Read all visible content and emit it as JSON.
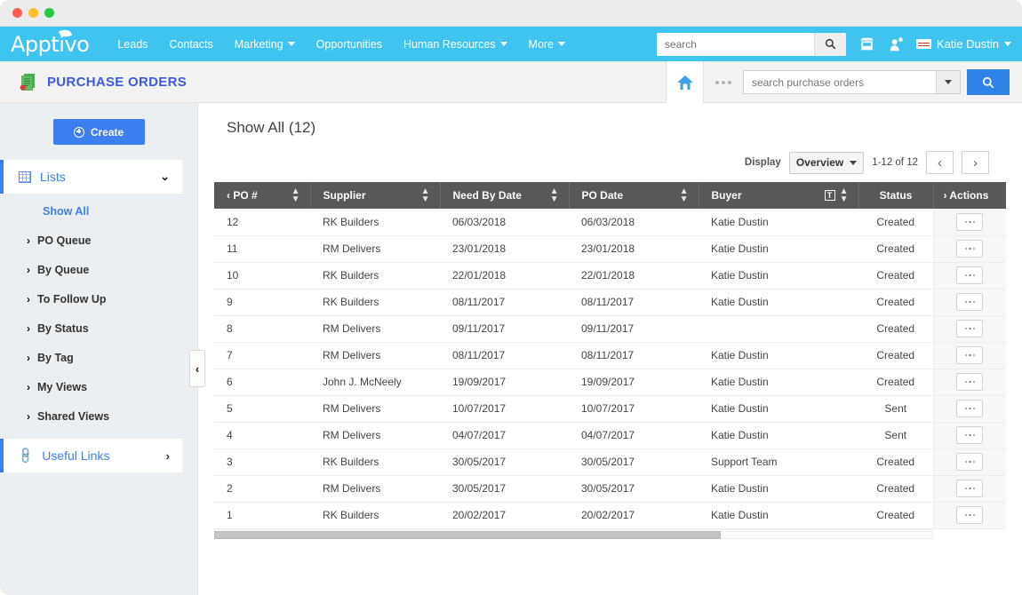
{
  "window": {
    "title": ""
  },
  "topnav": {
    "brand": "Apptivo",
    "links": [
      {
        "label": "Leads",
        "dropdown": false
      },
      {
        "label": "Contacts",
        "dropdown": false
      },
      {
        "label": "Marketing",
        "dropdown": true
      },
      {
        "label": "Opportunities",
        "dropdown": false
      },
      {
        "label": "Human Resources",
        "dropdown": true
      },
      {
        "label": "More",
        "dropdown": true
      }
    ],
    "search_placeholder": "search",
    "search_value": "",
    "user_name": "Katie Dustin",
    "icons": [
      "search-icon",
      "store-icon",
      "notifications-user-icon",
      "flag-icon",
      "chevron-down-icon"
    ]
  },
  "appbar": {
    "title": "PURCHASE ORDERS",
    "app_icon": "document-app-icon",
    "home_icon": "home-icon",
    "more_icon": "three-dots-icon",
    "search_placeholder": "search purchase orders",
    "search_value": "",
    "search_icon": "search-icon",
    "dropdown_icon": "chevron-down-icon"
  },
  "sidebar": {
    "create_label": "Create",
    "sections": [
      {
        "label": "Lists",
        "icon": "grid-icon",
        "chevron": "⌄",
        "expanded": true
      },
      {
        "label": "Useful Links",
        "icon": "link-icon",
        "chevron": "›",
        "expanded": false
      }
    ],
    "items": [
      {
        "label": "Show All",
        "active": true,
        "arrow": ""
      },
      {
        "label": "PO Queue",
        "active": false,
        "arrow": "›"
      },
      {
        "label": "By Queue",
        "active": false,
        "arrow": "›"
      },
      {
        "label": "To Follow Up",
        "active": false,
        "arrow": "›"
      },
      {
        "label": "By Status",
        "active": false,
        "arrow": "›"
      },
      {
        "label": "By Tag",
        "active": false,
        "arrow": "›"
      },
      {
        "label": "My Views",
        "active": false,
        "arrow": "›"
      },
      {
        "label": "Shared Views",
        "active": false,
        "arrow": "›"
      }
    ],
    "collapse_handle": "‹"
  },
  "main": {
    "list_title": "Show All (12)",
    "toolbar": {
      "display_label": "Display",
      "display_value": "Overview",
      "range_label": "1-12 of 12",
      "prev_icon": "‹",
      "next_icon": "›"
    },
    "table": {
      "columns": [
        {
          "label": "PO #",
          "sortable": true,
          "prefix_arrow": "‹",
          "filter": false,
          "key": "po",
          "align": "left"
        },
        {
          "label": "Supplier",
          "sortable": true,
          "prefix_arrow": "",
          "filter": false,
          "key": "supplier",
          "align": "left"
        },
        {
          "label": "Need By Date",
          "sortable": true,
          "prefix_arrow": "",
          "filter": false,
          "key": "need_by",
          "align": "left"
        },
        {
          "label": "PO Date",
          "sortable": true,
          "prefix_arrow": "",
          "filter": false,
          "key": "po_date",
          "align": "left"
        },
        {
          "label": "Buyer",
          "sortable": true,
          "prefix_arrow": "",
          "filter": true,
          "key": "buyer",
          "align": "left"
        },
        {
          "label": "Status",
          "sortable": false,
          "prefix_arrow": "",
          "filter": false,
          "key": "status",
          "align": "center"
        },
        {
          "label": "Actions",
          "sortable": false,
          "prefix_arrow": "›",
          "filter": false,
          "key": "actions",
          "align": "left"
        }
      ],
      "rows": [
        {
          "po": "12",
          "supplier": "RK Builders",
          "need_by": "06/03/2018",
          "po_date": "06/03/2018",
          "buyer": "Katie Dustin",
          "status": "Created"
        },
        {
          "po": "11",
          "supplier": "RM Delivers",
          "need_by": "23/01/2018",
          "po_date": "23/01/2018",
          "buyer": "Katie Dustin",
          "status": "Created"
        },
        {
          "po": "10",
          "supplier": "RK Builders",
          "need_by": "22/01/2018",
          "po_date": "22/01/2018",
          "buyer": "Katie Dustin",
          "status": "Created"
        },
        {
          "po": "9",
          "supplier": "RK Builders",
          "need_by": "08/11/2017",
          "po_date": "08/11/2017",
          "buyer": "Katie Dustin",
          "status": "Created"
        },
        {
          "po": "8",
          "supplier": "RM Delivers",
          "need_by": "09/11/2017",
          "po_date": "09/11/2017",
          "buyer": "",
          "status": "Created"
        },
        {
          "po": "7",
          "supplier": "RM Delivers",
          "need_by": "08/11/2017",
          "po_date": "08/11/2017",
          "buyer": "Katie Dustin",
          "status": "Created"
        },
        {
          "po": "6",
          "supplier": "John J. McNeely",
          "need_by": "19/09/2017",
          "po_date": "19/09/2017",
          "buyer": "Katie Dustin",
          "status": "Created"
        },
        {
          "po": "5",
          "supplier": "RM Delivers",
          "need_by": "10/07/2017",
          "po_date": "10/07/2017",
          "buyer": "Katie Dustin",
          "status": "Sent"
        },
        {
          "po": "4",
          "supplier": "RM Delivers",
          "need_by": "04/07/2017",
          "po_date": "04/07/2017",
          "buyer": "Katie Dustin",
          "status": "Sent"
        },
        {
          "po": "3",
          "supplier": "RK Builders",
          "need_by": "30/05/2017",
          "po_date": "30/05/2017",
          "buyer": "Support Team",
          "status": "Created"
        },
        {
          "po": "2",
          "supplier": "RM Delivers",
          "need_by": "30/05/2017",
          "po_date": "30/05/2017",
          "buyer": "Katie Dustin",
          "status": "Created"
        },
        {
          "po": "1",
          "supplier": "RK Builders",
          "need_by": "20/02/2017",
          "po_date": "20/02/2017",
          "buyer": "Katie Dustin",
          "status": "Created"
        }
      ],
      "row_action_icon": "three-dots-icon"
    },
    "hscroll": {
      "thumb_percent": 70.5
    }
  },
  "colors": {
    "brand_cyan": "#3fc4ef",
    "accent_blue": "#3d7ef0",
    "app_title_blue": "#3b5bdb",
    "table_header_gray": "#58585a",
    "sidebar_bg": "#eceff1",
    "search_button_blue": "#2f82e6"
  }
}
